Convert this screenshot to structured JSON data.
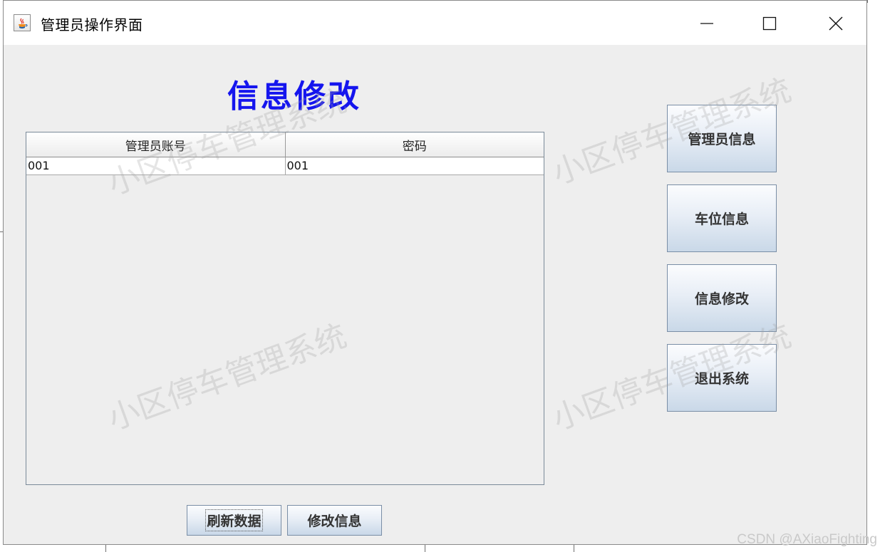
{
  "window": {
    "title": "管理员操作界面",
    "controls": {
      "minimize": "—",
      "maximize": "☐",
      "close": "✕"
    }
  },
  "page": {
    "heading": "信息修改"
  },
  "table": {
    "columns": [
      "管理员账号",
      "密码"
    ],
    "rows": [
      [
        "001",
        "001"
      ]
    ]
  },
  "side_buttons": [
    {
      "label": "管理员信息"
    },
    {
      "label": "车位信息"
    },
    {
      "label": "信息修改"
    },
    {
      "label": "退出系统"
    }
  ],
  "bottom_buttons": [
    {
      "label": "刷新数据"
    },
    {
      "label": "修改信息"
    }
  ],
  "watermark": {
    "text": "小区停车管理系统"
  },
  "source_mark": "CSDN @AXiaoFighting",
  "colors": {
    "heading": "#1515ee",
    "window_bg": "#eeeeee",
    "button_gradient_bottom": "#c9d8e8"
  }
}
